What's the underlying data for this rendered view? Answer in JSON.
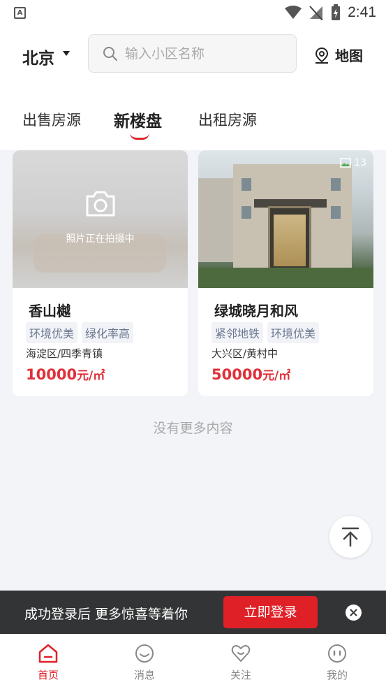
{
  "status_bar": {
    "time": "2:41",
    "app_icon": "A"
  },
  "header": {
    "city": "北京",
    "search_placeholder": "输入小区名称",
    "map_label": "地图"
  },
  "tabs": [
    {
      "label": "出售房源"
    },
    {
      "label": "新楼盘"
    },
    {
      "label": "出租房源"
    }
  ],
  "listings": [
    {
      "title": "香山樾",
      "tags": [
        "环境优美",
        "绿化率高"
      ],
      "location": "海淀区/四季青镇",
      "price": "10000",
      "unit": "元/㎡",
      "image_caption": "照片正在拍摄中"
    },
    {
      "title": "绿城晓月和风",
      "tags": [
        "紧邻地铁",
        "环境优美"
      ],
      "location": "大兴区/黄村中",
      "price": "50000",
      "unit": "元/㎡",
      "photo_count": "13"
    }
  ],
  "no_more_text": "没有更多内容",
  "login_banner": {
    "text": "成功登录后 更多惊喜等着你",
    "button": "立即登录"
  },
  "bottom_nav": [
    {
      "label": "首页",
      "icon": "home-icon",
      "active": true
    },
    {
      "label": "消息",
      "icon": "message-icon",
      "active": false
    },
    {
      "label": "关注",
      "icon": "heart-icon",
      "active": false
    },
    {
      "label": "我的",
      "icon": "profile-icon",
      "active": false
    }
  ],
  "colors": {
    "accent": "#e02027",
    "price": "#e0303a",
    "banner_bg": "#333435"
  }
}
